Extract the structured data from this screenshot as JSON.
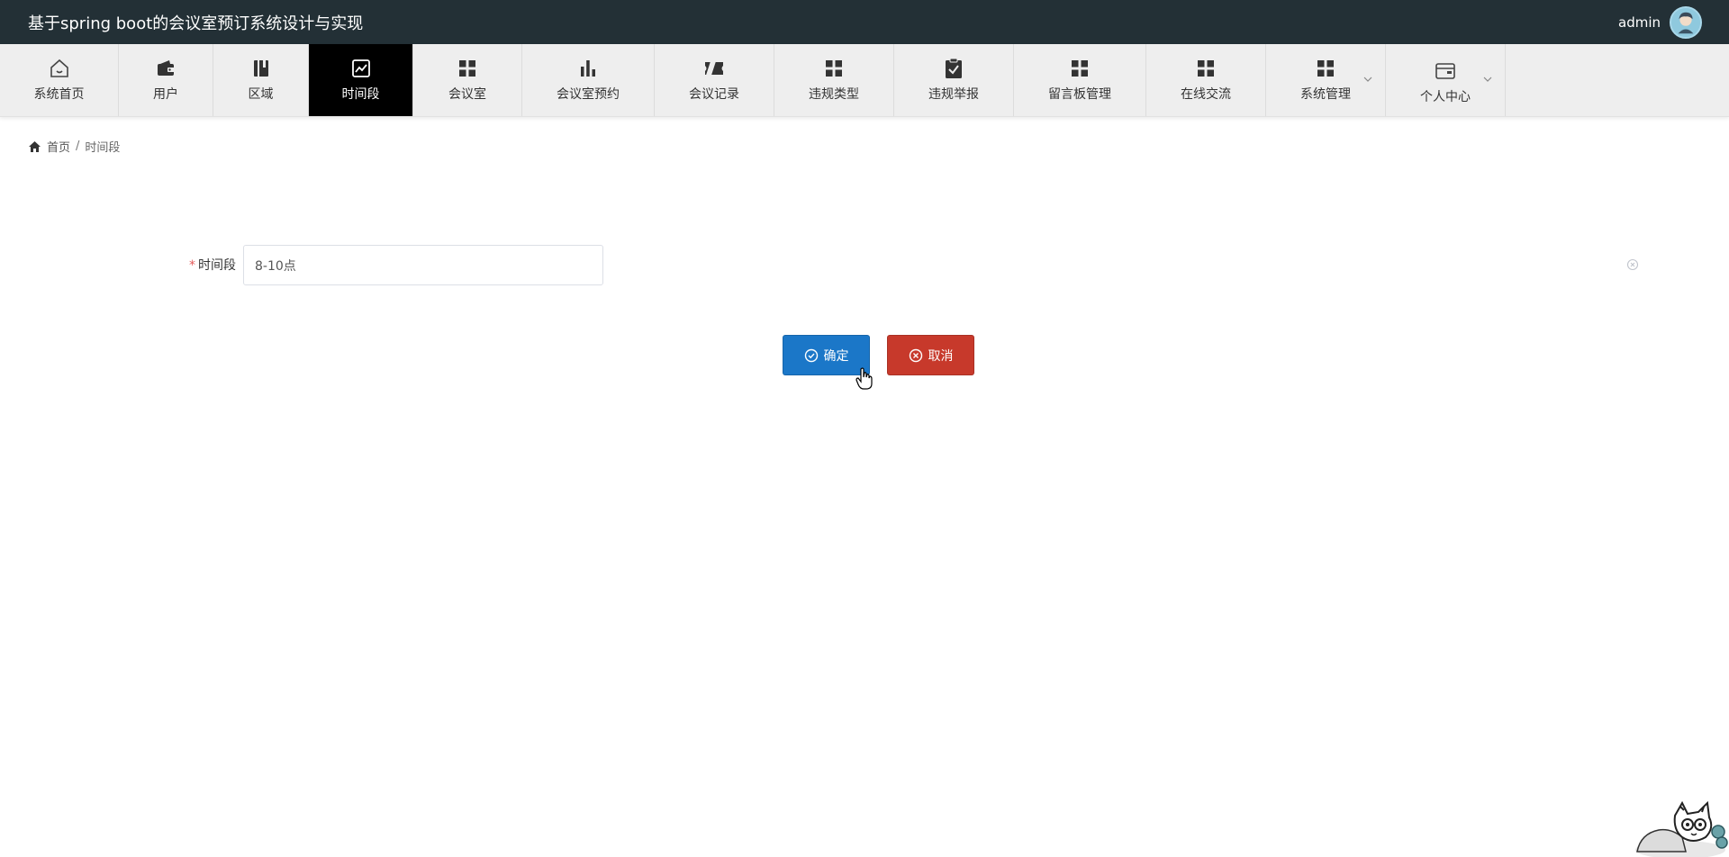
{
  "header": {
    "title": "基于spring boot的会议室预订系统设计与实现",
    "username": "admin"
  },
  "nav": {
    "items": [
      {
        "label": "系统首页",
        "icon": "home-icon"
      },
      {
        "label": "用户",
        "icon": "wallet-icon"
      },
      {
        "label": "区域",
        "icon": "book-icon"
      },
      {
        "label": "时间段",
        "icon": "chart-line-icon",
        "active": true
      },
      {
        "label": "会议室",
        "icon": "grid-icon"
      },
      {
        "label": "会议室预约",
        "icon": "bar-chart-icon"
      },
      {
        "label": "会议记录",
        "icon": "ticket-icon"
      },
      {
        "label": "违规类型",
        "icon": "grid-icon"
      },
      {
        "label": "违规举报",
        "icon": "clipboard-check-icon"
      },
      {
        "label": "留言板管理",
        "icon": "grid-icon"
      },
      {
        "label": "在线交流",
        "icon": "grid-icon"
      },
      {
        "label": "系统管理",
        "icon": "grid-icon",
        "dropdown": true
      },
      {
        "label": "个人中心",
        "icon": "card-icon",
        "dropdown": true
      }
    ]
  },
  "breadcrumb": {
    "home": "首页",
    "separator": "/",
    "current": "时间段"
  },
  "form": {
    "field_label": "时间段",
    "required_mark": "*",
    "field_value": "8-10点"
  },
  "buttons": {
    "confirm": "确定",
    "cancel": "取消"
  },
  "colors": {
    "header_bg": "#233036",
    "nav_bg": "#eeeeee",
    "nav_active_bg": "#000000",
    "confirm": "#1b77c8",
    "cancel": "#c7392b"
  }
}
